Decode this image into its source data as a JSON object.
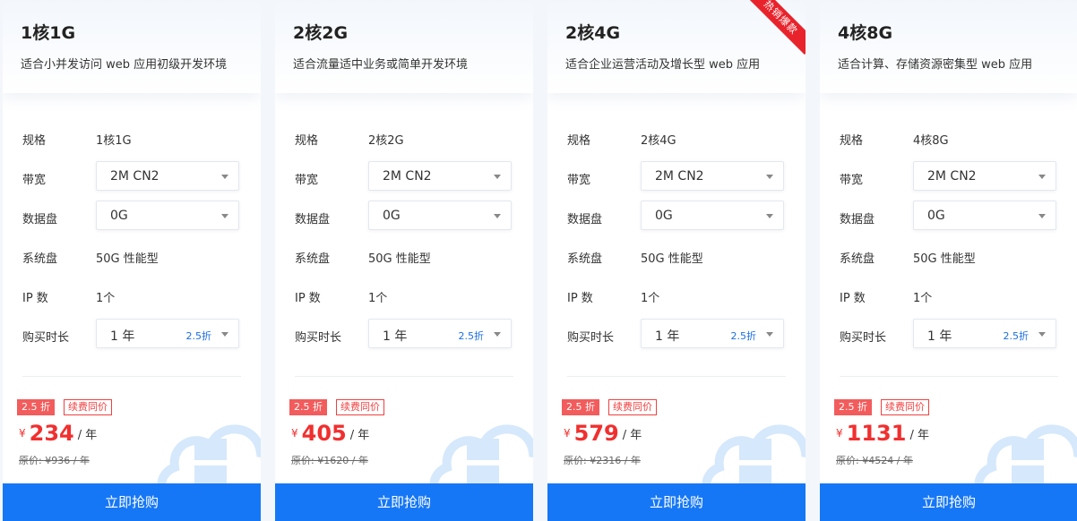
{
  "labels": {
    "spec": "规格",
    "bandwidth": "带宽",
    "data_disk": "数据盘",
    "system_disk": "系统盘",
    "ip_count": "IP 数",
    "duration": "购买时长"
  },
  "colors": {
    "accent": "#1677f6",
    "price": "#f0302f",
    "hot_ribbon": "#e8232b"
  },
  "plans": [
    {
      "title": "1核1G",
      "desc": "适合小并发访问 web 应用初级开发环境",
      "ribbon": "",
      "spec": "1核1G",
      "bandwidth": "2M CN2",
      "data_disk": "0G",
      "system_disk": "50G 性能型",
      "ip_count": "1个",
      "duration": "1 年",
      "duration_discount": "2.5折",
      "discount_tag": "2.5 折",
      "renew_tag": "续费同价",
      "currency": "¥",
      "price": "234",
      "unit": "/ 年",
      "original": "原价: ¥936 / 年",
      "buy": "立即抢购"
    },
    {
      "title": "2核2G",
      "desc": "适合流量适中业务或简单开发环境",
      "ribbon": "",
      "spec": "2核2G",
      "bandwidth": "2M CN2",
      "data_disk": "0G",
      "system_disk": "50G 性能型",
      "ip_count": "1个",
      "duration": "1 年",
      "duration_discount": "2.5折",
      "discount_tag": "2.5 折",
      "renew_tag": "续费同价",
      "currency": "¥",
      "price": "405",
      "unit": "/ 年",
      "original": "原价: ¥1620 / 年",
      "buy": "立即抢购"
    },
    {
      "title": "2核4G",
      "desc": "适合企业运营活动及增长型 web 应用",
      "ribbon": "热销爆款",
      "spec": "2核4G",
      "bandwidth": "2M CN2",
      "data_disk": "0G",
      "system_disk": "50G 性能型",
      "ip_count": "1个",
      "duration": "1 年",
      "duration_discount": "2.5折",
      "discount_tag": "2.5 折",
      "renew_tag": "续费同价",
      "currency": "¥",
      "price": "579",
      "unit": "/ 年",
      "original": "原价: ¥2316 / 年",
      "buy": "立即抢购"
    },
    {
      "title": "4核8G",
      "desc": "适合计算、存储资源密集型 web 应用",
      "ribbon": "",
      "spec": "4核8G",
      "bandwidth": "2M CN2",
      "data_disk": "0G",
      "system_disk": "50G 性能型",
      "ip_count": "1个",
      "duration": "1 年",
      "duration_discount": "2.5折",
      "discount_tag": "2.5 折",
      "renew_tag": "续费同价",
      "currency": "¥",
      "price": "1131",
      "unit": "/ 年",
      "original": "原价: ¥4524 / 年",
      "buy": "立即抢购"
    }
  ]
}
